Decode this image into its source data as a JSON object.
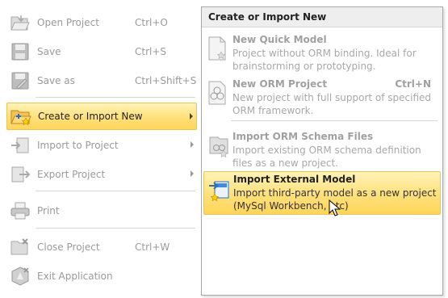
{
  "menu": {
    "items": [
      {
        "label": "Open Project",
        "shortcut": "Ctrl+O"
      },
      {
        "label": "Save",
        "shortcut": "Ctrl+S"
      },
      {
        "label": "Save as",
        "shortcut": "Ctrl+Shift+S"
      },
      {
        "label": "Create or Import New",
        "shortcut": ""
      },
      {
        "label": "Import to Project",
        "shortcut": ""
      },
      {
        "label": "Export Project",
        "shortcut": ""
      },
      {
        "label": "Print",
        "shortcut": ""
      },
      {
        "label": "Close Project",
        "shortcut": "Ctrl+W"
      },
      {
        "label": "Exit Application",
        "shortcut": ""
      }
    ]
  },
  "submenu": {
    "header": "Create or Import New",
    "items": [
      {
        "title": "New Quick Model",
        "shortcut": "",
        "description": "Project without ORM binding. Ideal for brainstorming or prototyping."
      },
      {
        "title": "New ORM Project",
        "shortcut": "Ctrl+N",
        "description": "New project with full support of specified ORM framework."
      },
      {
        "title": "Import ORM Schema Files",
        "shortcut": "",
        "description": "Import existing ORM schema definition files as a new project."
      },
      {
        "title": "Import External Model",
        "shortcut": "",
        "description": "Import third-party model as a new project (MySql Workbench, etc)"
      }
    ]
  },
  "colors": {
    "highlight": "#ffe07a",
    "highlight_border": "#e8c45a"
  }
}
